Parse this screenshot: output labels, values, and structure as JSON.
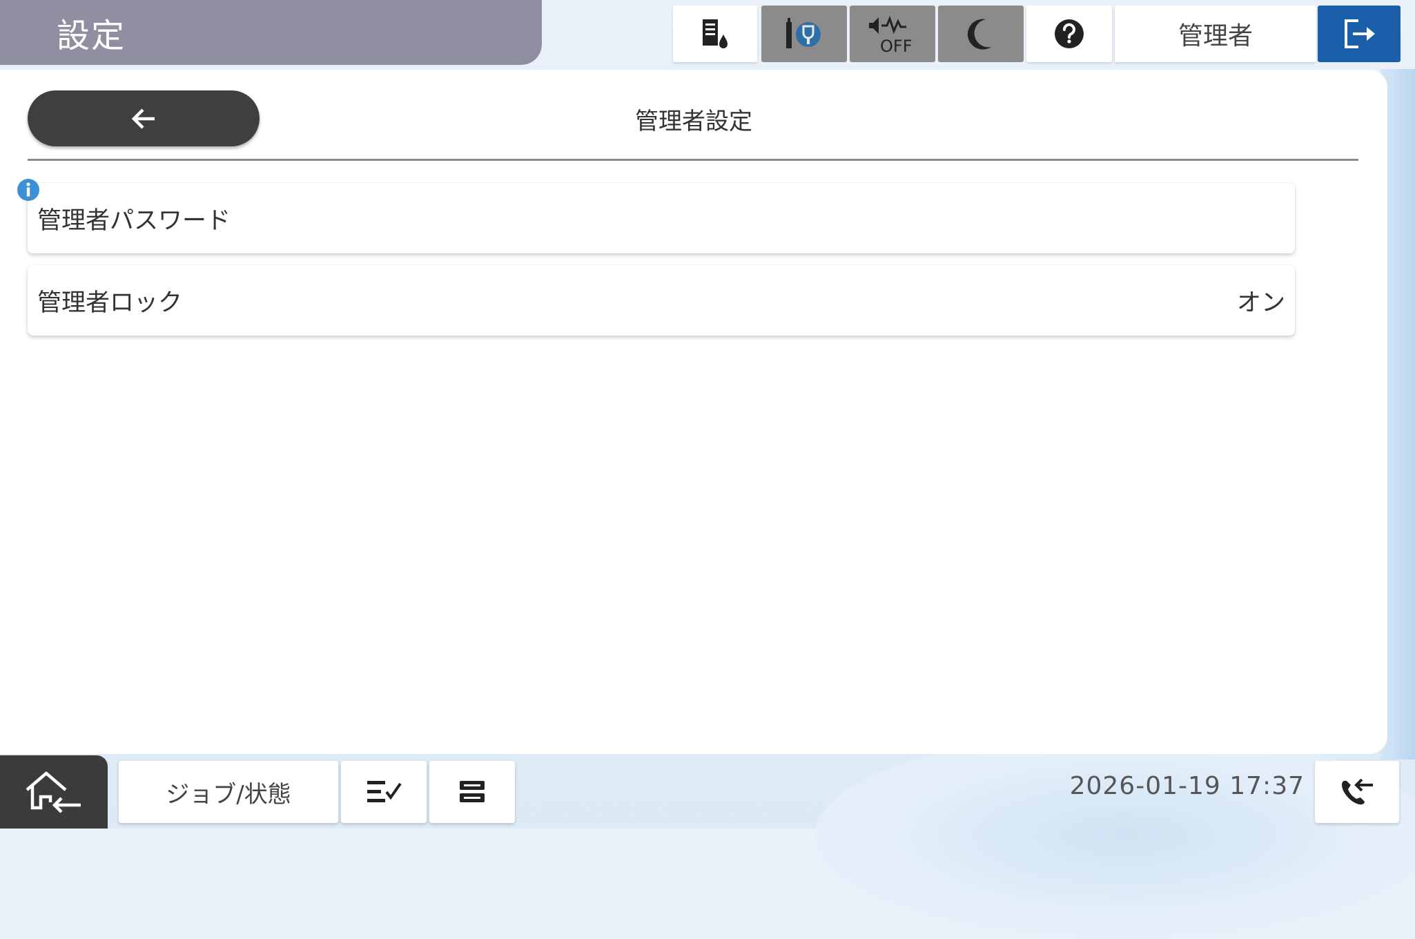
{
  "header": {
    "title": "設定",
    "icons": [
      "ink-level-icon",
      "wifi-direct-icon",
      "quiet-mode-off-icon",
      "sleep-icon",
      "help-icon"
    ],
    "quiet_off_text": "OFF",
    "user_label": "管理者",
    "logout_icon": "logout-icon"
  },
  "main": {
    "back_icon": "back-arrow-icon",
    "title": "管理者設定",
    "items": [
      {
        "label": "管理者パスワード",
        "value": "",
        "info": true
      },
      {
        "label": "管理者ロック",
        "value": "オン",
        "info": false
      }
    ]
  },
  "footer": {
    "home_icon": "home-icon",
    "job_status_label": "ジョブ/状態",
    "job_list_icon": "job-list-icon",
    "stop_icon": "stop-icon",
    "datetime": "2026-01-19 17:37",
    "fax_icon": "fax-receive-icon"
  },
  "colors": {
    "title_bar": "#8f8fa1",
    "logout_button": "#1a5ea9",
    "dark_button": "#3f3f3f",
    "info": "#3d8fd6"
  }
}
